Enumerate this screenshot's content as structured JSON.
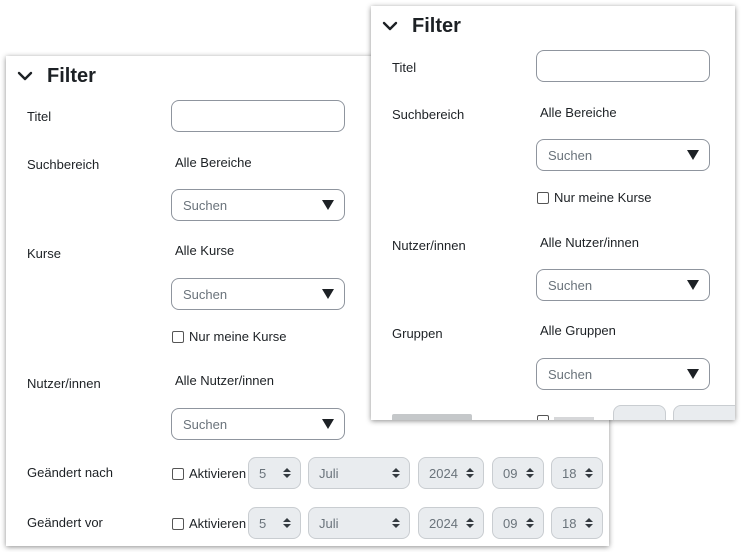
{
  "back": {
    "filter_title": "Filter",
    "titel_label": "Titel",
    "suchbereich_label": "Suchbereich",
    "suchbereich_value": "Alle Bereiche",
    "suchbereich_placeholder": "Suchen",
    "kurse_label": "Kurse",
    "kurse_value": "Alle Kurse",
    "kurse_placeholder": "Suchen",
    "nur_meine_kurse": "Nur meine Kurse",
    "nutzer_label": "Nutzer/innen",
    "nutzer_value": "Alle Nutzer/innen",
    "nutzer_placeholder": "Suchen",
    "geaendert_nach_label": "Geändert nach",
    "geaendert_vor_label": "Geändert vor",
    "aktivieren": "Aktivieren",
    "date_nach": {
      "day": "5",
      "month": "Juli",
      "year": "2024",
      "hour": "09",
      "minute": "18"
    },
    "date_vor": {
      "day": "5",
      "month": "Juli",
      "year": "2024",
      "hour": "09",
      "minute": "18"
    }
  },
  "front": {
    "filter_title": "Filter",
    "titel_label": "Titel",
    "suchbereich_label": "Suchbereich",
    "suchbereich_value": "Alle Bereiche",
    "suchbereich_placeholder": "Suchen",
    "nur_meine_kurse": "Nur meine Kurse",
    "nutzer_label": "Nutzer/innen",
    "nutzer_value": "Alle Nutzer/innen",
    "nutzer_placeholder": "Suchen",
    "gruppen_label": "Gruppen",
    "gruppen_value": "Alle Gruppen",
    "gruppen_placeholder": "Suchen"
  },
  "icons": {
    "collapse": "chevron-down-icon",
    "dropdown": "caret-down-icon",
    "spinner": "up-down-arrows-icon"
  }
}
